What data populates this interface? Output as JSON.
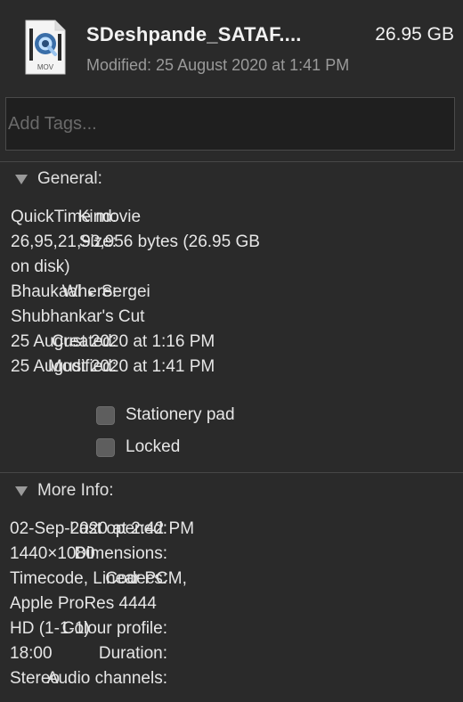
{
  "header": {
    "icon_name": "quicktime-mov-file-icon",
    "icon_badge": "MOV",
    "file_name": "SDeshpande_SATAF....",
    "file_size": "26.95 GB",
    "modified": "Modified: 25 August 2020 at 1:41 PM"
  },
  "tags": {
    "placeholder": "Add Tags..."
  },
  "general": {
    "title": "General:",
    "kind_label": "Kind:",
    "kind_value": "QuickTime movie",
    "size_label": "Size:",
    "size_value_1": "26,95,21,93,956 bytes (26.95 GB",
    "size_value_2": "on disk)",
    "where_label": "Where:",
    "where_folder": "Bhaukaal",
    "where_sep": "▸",
    "where_sub": "Sergei",
    "where_value_2": "Shubhankar's Cut",
    "created_label": "Created:",
    "created_value": "25 August 2020 at 1:16 PM",
    "modified_label": "Modified:",
    "modified_value": "25 August 2020 at 1:41 PM",
    "stationery_label": "Stationery pad",
    "locked_label": "Locked"
  },
  "more_info": {
    "title": "More Info:",
    "last_opened_label": "Last opened:",
    "last_opened_value": "02-Sep-2020 at 2:42 PM",
    "dimensions_label": "Dimensions:",
    "dimensions_value": "1440×1080",
    "codecs_label": "Codecs:",
    "codecs_value_1": "Timecode, Linear PCM,",
    "codecs_value_2": "Apple ProRes 4444",
    "colour_label": "Colour profile:",
    "colour_value": "HD (1-1-1)",
    "duration_label": "Duration:",
    "duration_value": "18:00",
    "audio_label": "Audio channels:",
    "audio_value": "Stereo"
  }
}
